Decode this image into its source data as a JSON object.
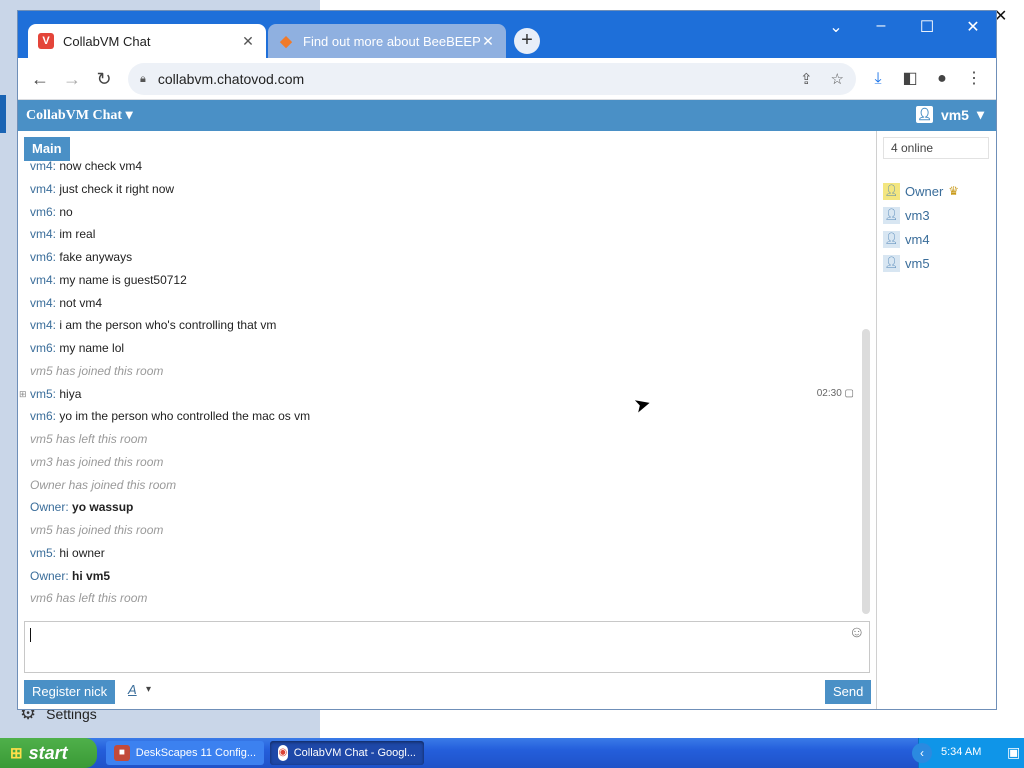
{
  "browser": {
    "tabs": [
      {
        "title": "CollabVM Chat",
        "active": true,
        "icon": "collabvm-tab-icon"
      },
      {
        "title": "Find out more about BeeBEEP (F",
        "active": false,
        "icon": "beebeep-tab-icon"
      }
    ],
    "url": "collabvm.chatovod.com"
  },
  "app": {
    "title": "CollabVM Chat",
    "current_user": "vm5",
    "main_tab": "Main",
    "online_count": "4 online",
    "register_label": "Register nick",
    "font_label": "A",
    "send_label": "Send"
  },
  "messages": [
    {
      "nick": "vm4:",
      "text": "now check vm4",
      "system": false,
      "bold": false
    },
    {
      "nick": "vm4:",
      "text": "just check it right now",
      "system": false,
      "bold": false
    },
    {
      "nick": "vm6:",
      "text": "no",
      "system": false,
      "bold": false
    },
    {
      "nick": "vm4:",
      "text": "im real",
      "system": false,
      "bold": false
    },
    {
      "nick": "vm6:",
      "text": "fake anyways",
      "system": false,
      "bold": false
    },
    {
      "nick": "vm4:",
      "text": "my name is guest50712",
      "system": false,
      "bold": false
    },
    {
      "nick": "vm4:",
      "text": "not vm4",
      "system": false,
      "bold": false
    },
    {
      "nick": "vm4:",
      "text": "i am the person who's controlling that vm",
      "system": false,
      "bold": false
    },
    {
      "nick": "vm6:",
      "text": "my name lol",
      "system": false,
      "bold": false
    },
    {
      "nick": "",
      "text": "vm5 has joined this room",
      "system": true,
      "bold": false
    },
    {
      "nick": "vm5:",
      "text": "hiya",
      "system": false,
      "bold": false,
      "time": "02:30"
    },
    {
      "nick": "vm6:",
      "text": "yo im the person who controlled the mac os vm",
      "system": false,
      "bold": false
    },
    {
      "nick": "",
      "text": "vm5 has left this room",
      "system": true,
      "bold": false
    },
    {
      "nick": "",
      "text": "vm3 has joined this room",
      "system": true,
      "bold": false
    },
    {
      "nick": "",
      "text": "Owner has joined this room",
      "system": true,
      "bold": false
    },
    {
      "nick": "Owner:",
      "text": "yo wassup",
      "system": false,
      "bold": true
    },
    {
      "nick": "",
      "text": "vm5 has joined this room",
      "system": true,
      "bold": false
    },
    {
      "nick": "vm5:",
      "text": "hi owner",
      "system": false,
      "bold": false
    },
    {
      "nick": "Owner:",
      "text": "hi vm5",
      "system": false,
      "bold": true
    },
    {
      "nick": "",
      "text": "vm6 has left this room",
      "system": true,
      "bold": false
    }
  ],
  "users": [
    {
      "name": "Owner",
      "owner": true
    },
    {
      "name": "vm3",
      "owner": false
    },
    {
      "name": "vm4",
      "owner": false
    },
    {
      "name": "vm5",
      "owner": false
    }
  ],
  "desktop": {
    "settings_label": "Settings"
  },
  "taskbar": {
    "start_label": "start",
    "tasks": [
      {
        "title": "DeskScapes 11 Config..."
      },
      {
        "title": "CollabVM Chat - Googl..."
      }
    ],
    "clock": "5:34 AM"
  },
  "colors": {
    "accent": "#4a90c6",
    "browser_frame": "#1e6fd9",
    "nick_color": "#3a6d9a",
    "system_text": "#999999"
  }
}
